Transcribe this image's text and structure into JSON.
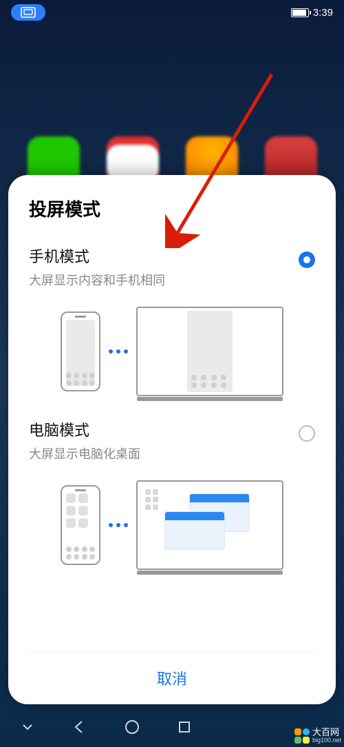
{
  "status": {
    "time": "3:39"
  },
  "sheet": {
    "title": "投屏模式",
    "options": {
      "phone": {
        "title": "手机模式",
        "sub": "大屏显示内容和手机相同",
        "selected": true
      },
      "pc": {
        "title": "电脑模式",
        "sub": "大屏显示电脑化桌面",
        "selected": false
      }
    },
    "cancel": "取消"
  },
  "watermark": {
    "name": "大百网",
    "url": "big100.net"
  }
}
